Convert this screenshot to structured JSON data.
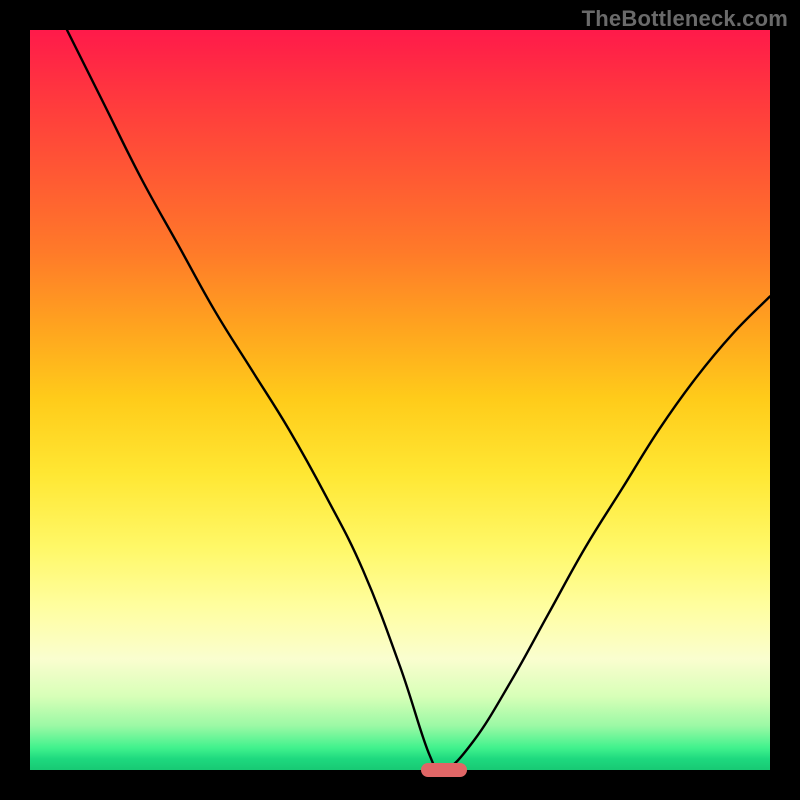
{
  "watermark": "TheBottleneck.com",
  "chart_data": {
    "type": "line",
    "title": "",
    "xlabel": "",
    "ylabel": "",
    "xlim": [
      0,
      100
    ],
    "ylim": [
      0,
      100
    ],
    "grid": false,
    "legend": false,
    "series": [
      {
        "name": "curve",
        "x": [
          5,
          10,
          15,
          20,
          25,
          30,
          35,
          40,
          45,
          50,
          54,
          56,
          60,
          65,
          70,
          75,
          80,
          85,
          90,
          95,
          100
        ],
        "values": [
          100,
          90,
          80,
          71,
          62,
          54,
          46,
          37,
          27,
          14,
          2,
          0,
          4,
          12,
          21,
          30,
          38,
          46,
          53,
          59,
          64
        ]
      }
    ],
    "marker": {
      "x": 56,
      "y": 0,
      "shape": "pill",
      "color": "#e06666"
    },
    "gradient_stops": [
      {
        "pct": 0,
        "color": "#ff1a4a"
      },
      {
        "pct": 50,
        "color": "#ffcc1a"
      },
      {
        "pct": 85,
        "color": "#fafecf"
      },
      {
        "pct": 100,
        "color": "#18c974"
      }
    ]
  }
}
